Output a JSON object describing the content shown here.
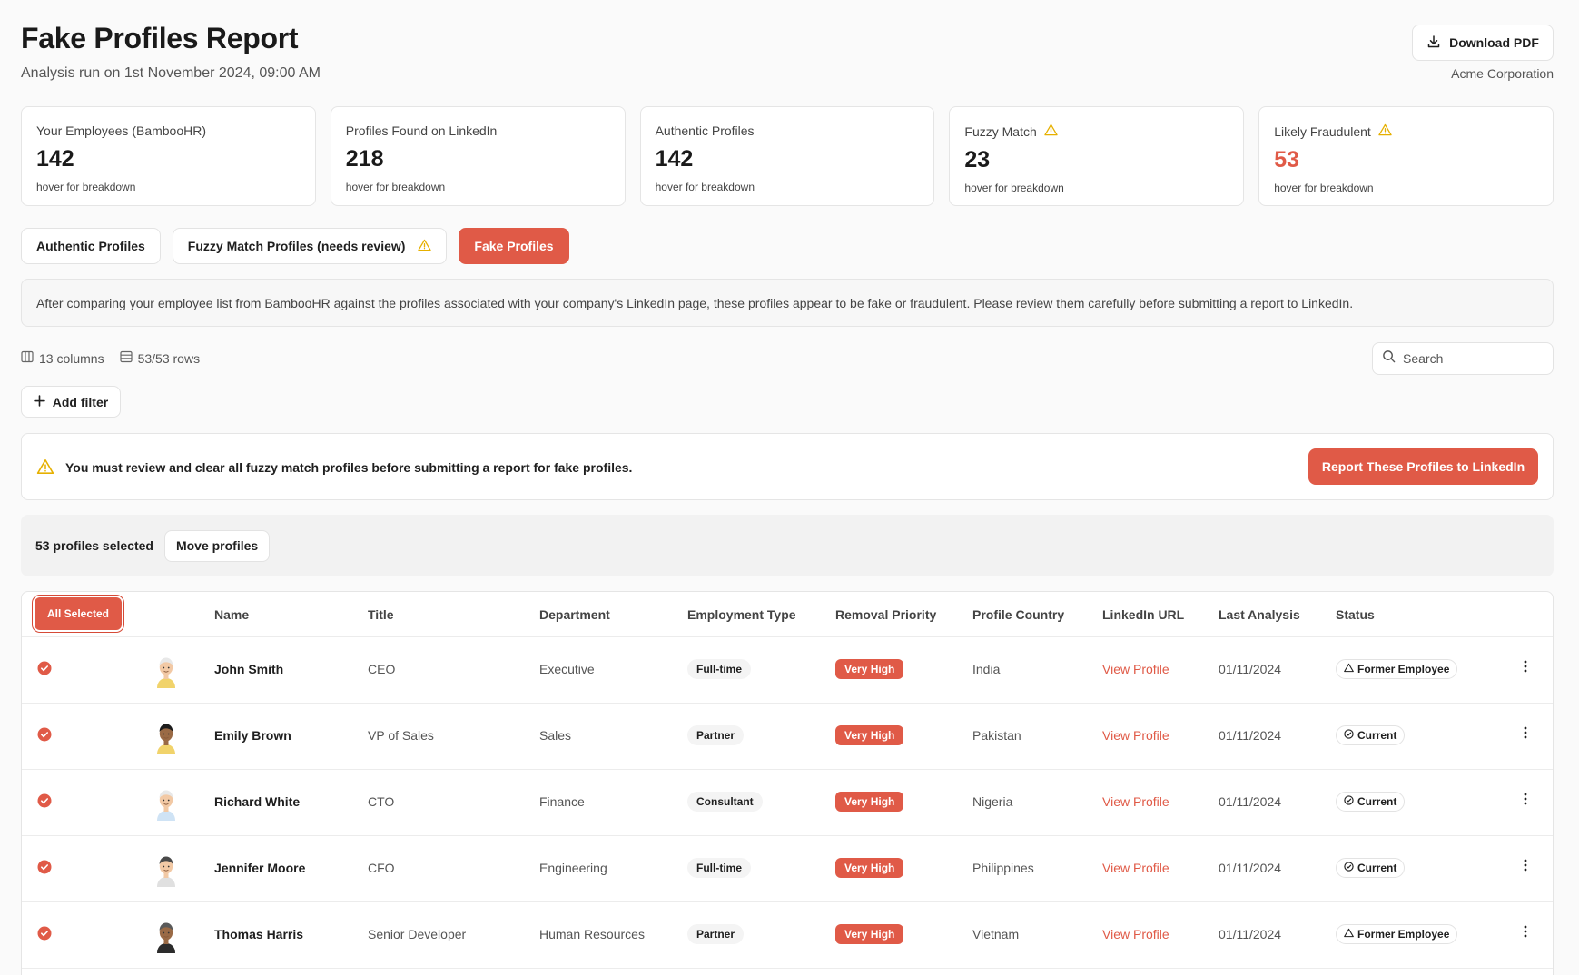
{
  "header": {
    "title": "Fake Profiles Report",
    "subtitle": "Analysis run on 1st November 2024, 09:00 AM",
    "download_label": "Download PDF",
    "company": "Acme Corporation"
  },
  "cards": [
    {
      "label": "Your Employees (BambooHR)",
      "value": "142",
      "hint": "hover for breakdown",
      "warning": false,
      "danger": false
    },
    {
      "label": "Profiles Found on LinkedIn",
      "value": "218",
      "hint": "hover for breakdown",
      "warning": false,
      "danger": false
    },
    {
      "label": "Authentic Profiles",
      "value": "142",
      "hint": "hover for breakdown",
      "warning": false,
      "danger": false
    },
    {
      "label": "Fuzzy Match",
      "value": "23",
      "hint": "hover for breakdown",
      "warning": true,
      "danger": false
    },
    {
      "label": "Likely Fraudulent",
      "value": "53",
      "hint": "hover for breakdown",
      "warning": true,
      "danger": true
    }
  ],
  "tabs": {
    "authentic": "Authentic Profiles",
    "fuzzy": "Fuzzy Match Profiles (needs review)",
    "fake": "Fake Profiles",
    "active": "fake"
  },
  "description": "After comparing your employee list from BambooHR against the profiles associated with your company's LinkedIn page, these profiles appear to be fake or fraudulent. Please review them carefully before submitting a report to LinkedIn.",
  "meta": {
    "columns": "13 columns",
    "rows": "53/53 rows"
  },
  "search": {
    "placeholder": "Search"
  },
  "add_filter_label": "Add filter",
  "warning": {
    "text": "You must review and clear all fuzzy match profiles before submitting a report for fake profiles.",
    "button": "Report These Profiles to LinkedIn"
  },
  "selection": {
    "count": "53 profiles selected",
    "move_label": "Move profiles"
  },
  "table": {
    "select_label": "All Selected",
    "headers": {
      "name": "Name",
      "title": "Title",
      "department": "Department",
      "employment_type": "Employment Type",
      "removal_priority": "Removal Priority",
      "profile_country": "Profile Country",
      "linkedin_url": "LinkedIn URL",
      "last_analysis": "Last Analysis",
      "status": "Status"
    },
    "rows": [
      {
        "name": "John Smith",
        "title": "CEO",
        "department": "Executive",
        "employment_type": "Full-time",
        "priority": "Very High",
        "country": "India",
        "link": "View Profile",
        "date": "01/11/2024",
        "status": "Former Employee",
        "status_icon": "warning-triangle-icon"
      },
      {
        "name": "Emily Brown",
        "title": "VP of Sales",
        "department": "Sales",
        "employment_type": "Partner",
        "priority": "Very High",
        "country": "Pakistan",
        "link": "View Profile",
        "date": "01/11/2024",
        "status": "Current",
        "status_icon": "check-circle-icon"
      },
      {
        "name": "Richard White",
        "title": "CTO",
        "department": "Finance",
        "employment_type": "Consultant",
        "priority": "Very High",
        "country": "Nigeria",
        "link": "View Profile",
        "date": "01/11/2024",
        "status": "Current",
        "status_icon": "check-circle-icon"
      },
      {
        "name": "Jennifer Moore",
        "title": "CFO",
        "department": "Engineering",
        "employment_type": "Full-time",
        "priority": "Very High",
        "country": "Philippines",
        "link": "View Profile",
        "date": "01/11/2024",
        "status": "Current",
        "status_icon": "check-circle-icon"
      },
      {
        "name": "Thomas Harris",
        "title": "Senior Developer",
        "department": "Human Resources",
        "employment_type": "Partner",
        "priority": "Very High",
        "country": "Vietnam",
        "link": "View Profile",
        "date": "01/11/2024",
        "status": "Former Employee",
        "status_icon": "warning-triangle-icon"
      }
    ]
  },
  "colors": {
    "accent": "#e05a47",
    "warning": "#e6b000",
    "background": "#fafafa"
  }
}
